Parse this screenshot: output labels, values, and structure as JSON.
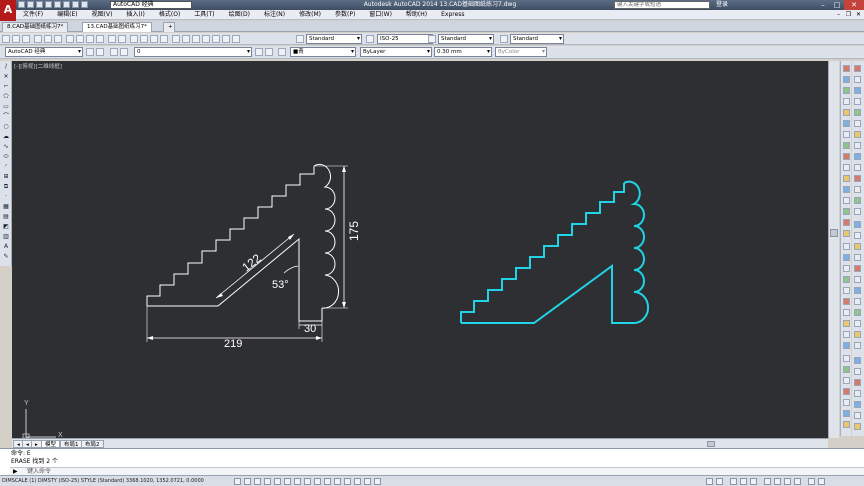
{
  "titlebar": {
    "app_logo": "A",
    "workspace": "AutoCAD 经典",
    "title": "Autodesk AutoCAD 2014    13.CAD基础图纸练习7.dwg",
    "search_placeholder": "键入关键字或短语",
    "login": "登录",
    "minimize": "–",
    "maximize": "□",
    "close": "✕"
  },
  "menubar": {
    "items": [
      "文件(F)",
      "编辑(E)",
      "视图(V)",
      "插入(I)",
      "格式(O)",
      "工具(T)",
      "绘图(D)",
      "标注(N)",
      "修改(M)",
      "参数(P)",
      "窗口(W)",
      "帮助(H)",
      "Express"
    ]
  },
  "doctabs": [
    {
      "label": "8.CAD基础图纸练习7*"
    },
    {
      "label": "13.CAD基础图纸练习7*"
    }
  ],
  "toolbar1": {
    "text_style": "Standard",
    "dim_style": "ISO-25",
    "table_style": "Standard",
    "mleader_style": "Standard"
  },
  "toolbar2": {
    "workspace": "AutoCAD 经典",
    "layer": "0",
    "color": "■青",
    "linetype": "ByLayer",
    "lineweight": "0.30 mm",
    "plotstyle": "ByColor"
  },
  "viewport": {
    "label": "[-][俯视][二维线框]"
  },
  "dimensions": {
    "d1": "122",
    "d2": "175",
    "d3": "53°",
    "d4": "30",
    "d5": "219"
  },
  "ucs": {
    "y": "Y",
    "x": "X"
  },
  "layout_tabs": [
    "模型",
    "布局1",
    "布局2"
  ],
  "command": {
    "history1": "命令: E",
    "history2": "ERASE 找到 2 个",
    "prompt": "键入命令",
    "side_close": "✕"
  },
  "status": {
    "text": "DIMSCALE (1) DIMSTY (ISO-25) STYLE (Standard)  3368.1020, 1352.0721, 0.0000"
  },
  "colors": {
    "canvas": "#2d2f33",
    "white_lines": "#ffffff",
    "cyan_lines": "#21d3e6"
  }
}
